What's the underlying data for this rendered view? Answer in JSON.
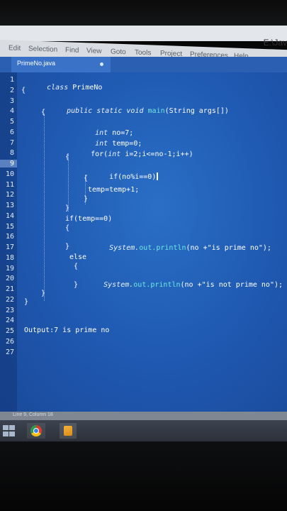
{
  "window": {
    "title": "E:\\Jav"
  },
  "menu": [
    "Edit",
    "Selection",
    "Find",
    "View",
    "Goto",
    "Tools",
    "Project",
    "Preferences",
    "Help"
  ],
  "tab": {
    "label": "PrimeNo.java"
  },
  "editor": {
    "line_numbers": [
      "1",
      "2",
      "3",
      "4",
      "5",
      "6",
      "7",
      "8",
      "9",
      "10",
      "11",
      "12",
      "13",
      "14",
      "15",
      "16",
      "17",
      "18",
      "19",
      "20",
      "21",
      "22",
      "23",
      "24",
      "25",
      "26",
      "27"
    ],
    "active_line": "9",
    "code": {
      "l1_kw": "class",
      "l1_name": "PrimeNo",
      "l2": "{",
      "l3_mods": "public static void",
      "l3_fn": "main",
      "l3_args": "(String args[])",
      "l4": "{",
      "l5_kw": "int",
      "l5_rest": "no=7;",
      "l6_kw": "int",
      "l6_rest": "temp=0;",
      "l7_for": "for(",
      "l7_kw": "int",
      "l7_rest": "i=2;i<=no-1;i++)",
      "l8": "{",
      "l9": "if(no%i==0)",
      "l10": "{",
      "l11": "temp=temp+1;",
      "l12": "}",
      "l13": "}",
      "l14": "if(temp==0)",
      "l15": "{",
      "l16_kw": "System.",
      "l16_fn": "out.println",
      "l16_rest": "(no +\"is prime no\");",
      "l17": "}",
      "l18": "else",
      "l19": "{",
      "l20_kw": "System.",
      "l20_fn": "out.println",
      "l20_rest": "(no +\"is not prime no\");",
      "l21": "}",
      "l22": "}",
      "l23": "}",
      "l26": "Output:7 is prime no"
    }
  },
  "status": {
    "text": "Line 9, Column 18"
  },
  "colors": {
    "editor_bg": "#2365bd",
    "tab_bar": "#2b5fb2",
    "function": "#6ee7e0"
  }
}
